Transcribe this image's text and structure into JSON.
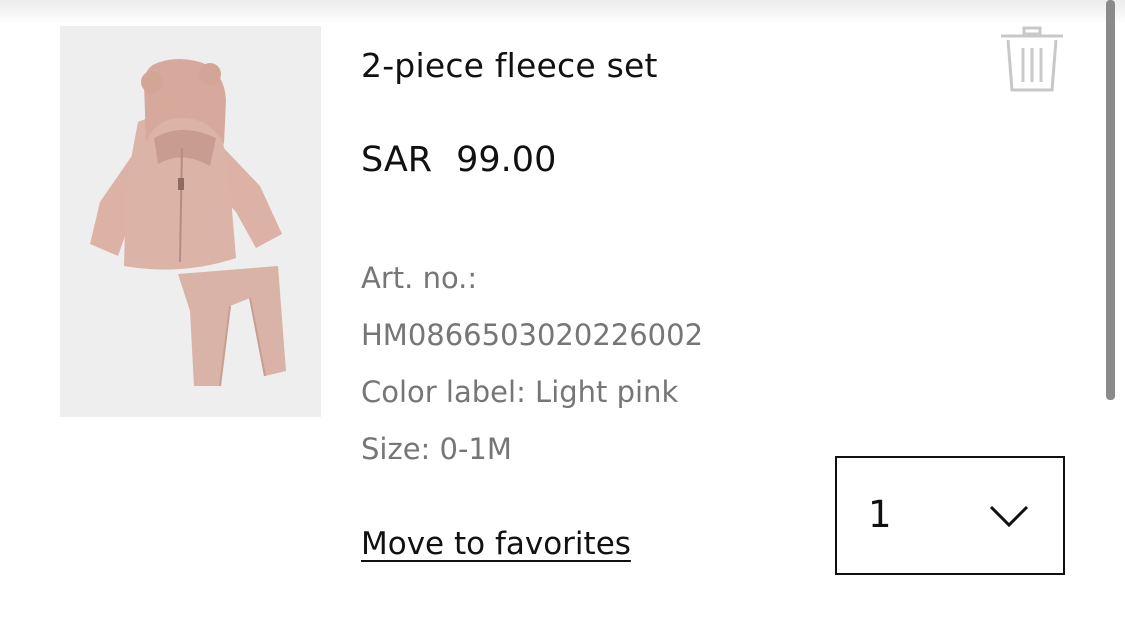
{
  "product": {
    "title": "2-piece fleece set",
    "currency": "SAR",
    "price": "99.00",
    "image_alt": "pink fleece hooded jacket and pants",
    "art_no_label": "Art. no.:",
    "art_no_value": "HM0866503020226002",
    "color_label": "Color label: Light pink",
    "size_label": "Size: 0-1M"
  },
  "actions": {
    "move_to_favorites": "Move to favorites",
    "quantity": "1",
    "remove_icon": "trash-icon",
    "dropdown_icon": "chevron-down-icon"
  },
  "colors": {
    "text": "#111111",
    "muted_text": "#767676",
    "image_bg": "#eeeeee",
    "garment": "#d9b0a4",
    "icon_gray": "#c8c8c8"
  }
}
